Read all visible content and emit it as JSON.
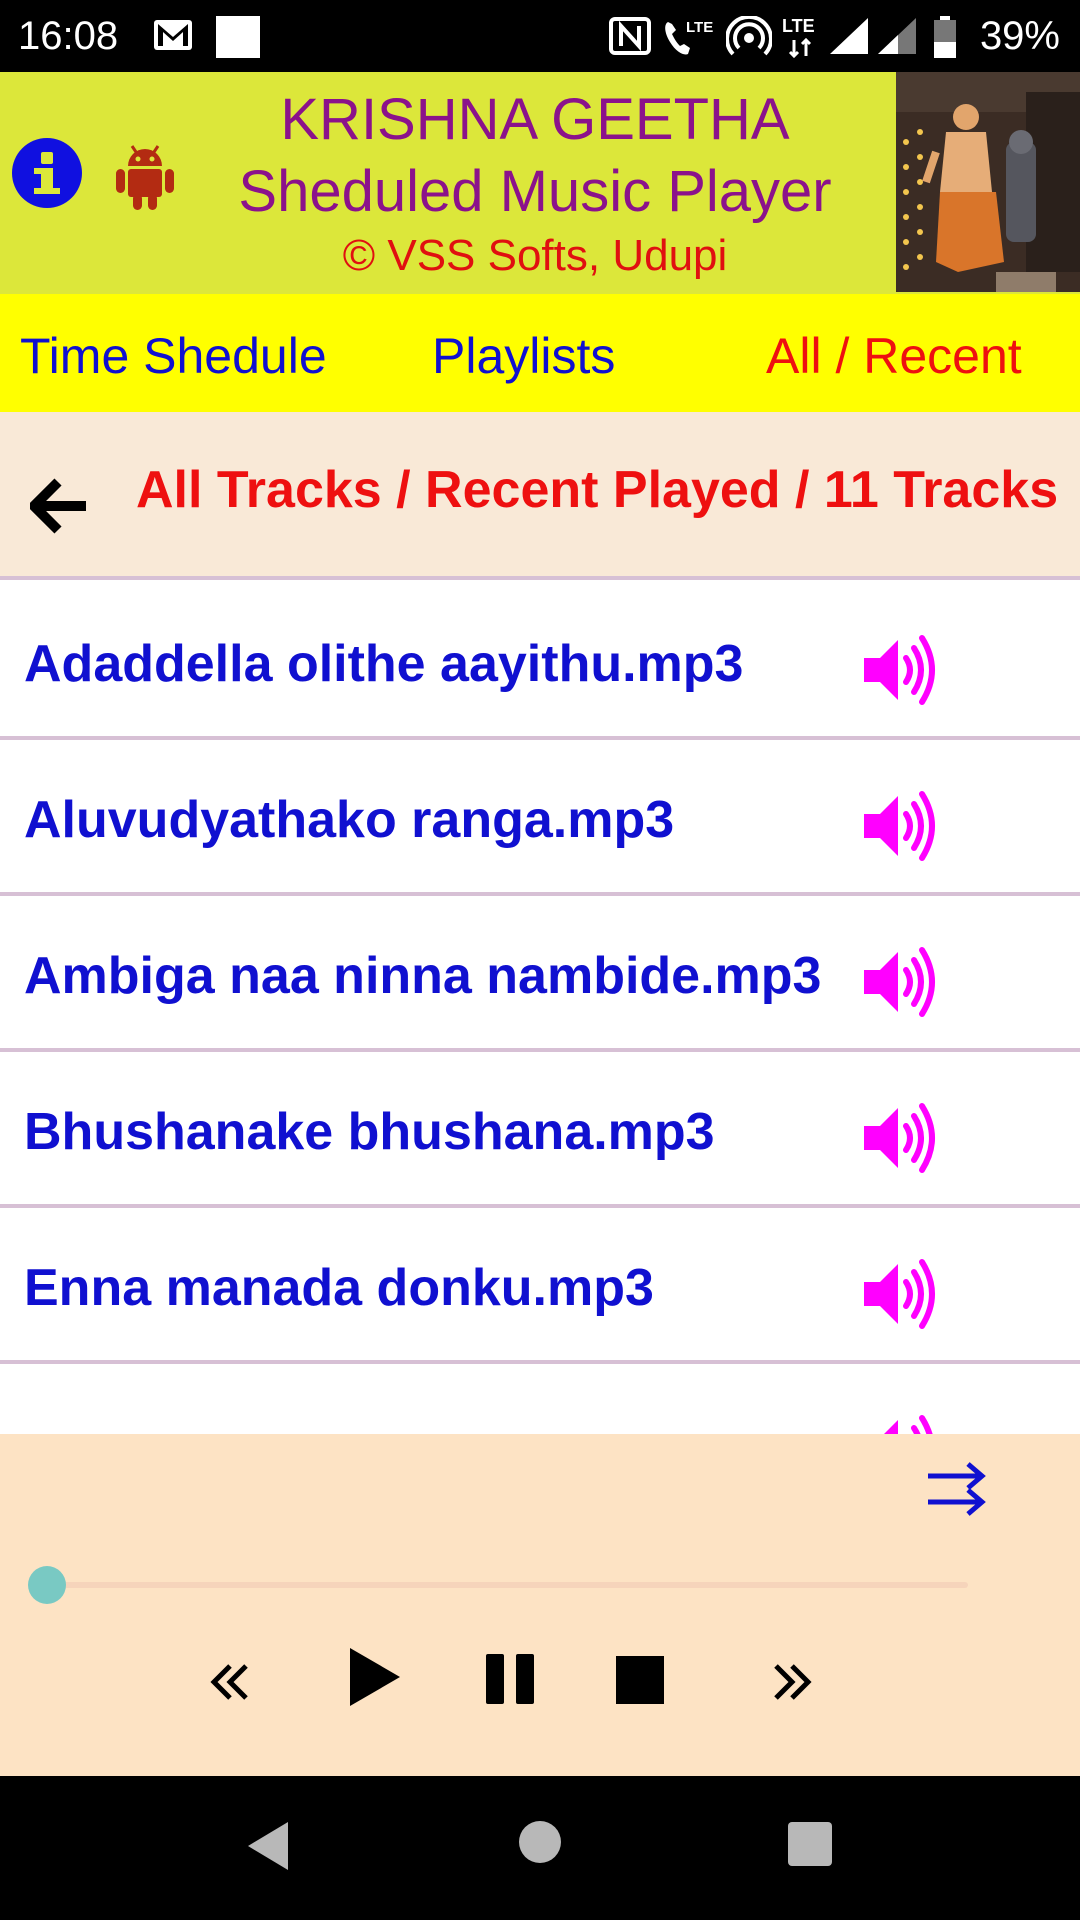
{
  "status_bar": {
    "time": "16:08",
    "battery": "39%",
    "icons": [
      "gmail-icon",
      "notification-square-icon",
      "nfc-icon",
      "volte-call-icon",
      "hotspot-icon",
      "lte-icon",
      "signal-icon",
      "signal-icon",
      "battery-icon"
    ]
  },
  "header": {
    "title_line1": "KRISHNA GEETHA",
    "title_line2": "Sheduled Music Player",
    "copyright": "© VSS Softs, Udupi",
    "info_icon": "info-icon",
    "android_icon": "android-icon",
    "image": "krishna-devotee-photo"
  },
  "tabs": [
    {
      "label": "Time Shedule",
      "active": false
    },
    {
      "label": "Playlists",
      "active": false
    },
    {
      "label": "All / Recent",
      "active": true
    }
  ],
  "section": {
    "title": "All Tracks / Recent Played / 11 Tracks",
    "back_icon": "back-arrow-icon"
  },
  "tracks": [
    {
      "name": "Adaddella olithe aayithu.mp3"
    },
    {
      "name": "Aluvudyathako ranga.mp3"
    },
    {
      "name": "Ambiga naa ninna nambide.mp3"
    },
    {
      "name": "Bhushanake bhushana.mp3"
    },
    {
      "name": "Enna manada donku.mp3"
    }
  ],
  "player": {
    "progress": 0,
    "controls": [
      "rewind-icon",
      "play-icon",
      "pause-icon",
      "stop-icon",
      "fast-forward-icon"
    ],
    "shuffle_icon": "shuffle-icon"
  },
  "colors": {
    "header_bg": "#dce73a",
    "tab_bg": "#ffff00",
    "title_purple": "#8b128b",
    "accent_red": "#ee1010",
    "track_blue": "#1010d0",
    "speaker_magenta": "#ff00ff",
    "player_bg": "#fde3c4"
  }
}
